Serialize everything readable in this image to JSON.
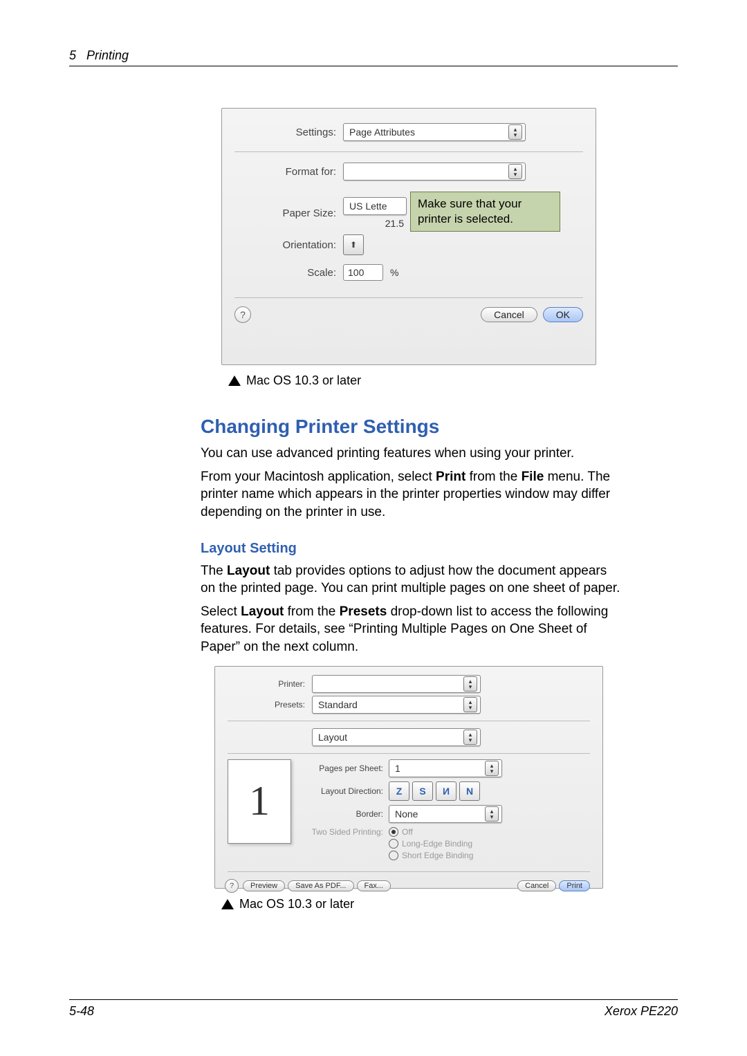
{
  "header": {
    "chapter_num": "5",
    "chapter_title": "Printing"
  },
  "dialog1": {
    "rows": {
      "settings": {
        "label": "Settings:",
        "value": "Page Attributes"
      },
      "format_for": {
        "label": "Format for:",
        "value": ""
      },
      "paper_size": {
        "label": "Paper Size:",
        "value": "US Lette",
        "sub": "21.5"
      },
      "orientation": {
        "label": "Orientation:"
      },
      "scale": {
        "label": "Scale:",
        "value": "100",
        "unit": "%"
      }
    },
    "callout": "Make sure that your printer is selected.",
    "buttons": {
      "cancel": "Cancel",
      "ok": "OK"
    }
  },
  "caption1": "Mac OS 10.3 or later",
  "section": {
    "title": "Changing Printer Settings",
    "p1": "You can use advanced printing features when using your printer.",
    "p2_a": "From your Macintosh application, select ",
    "p2_b": "Print",
    "p2_c": " from the ",
    "p2_d": "File",
    "p2_e": " menu. The printer name which appears in the printer properties window may differ depending on the printer in use."
  },
  "subsection": {
    "title": "Layout Setting",
    "p1_a": "The ",
    "p1_b": "Layout",
    "p1_c": " tab provides options to adjust how the document appears on the printed page. You can print multiple pages on one sheet of paper.",
    "p2_a": "Select ",
    "p2_b": "Layout",
    "p2_c": " from the ",
    "p2_d": "Presets",
    "p2_e": " drop-down list to access the following features. For details, see “Printing Multiple Pages on One Sheet of Paper” on the next column."
  },
  "dialog2": {
    "printer_label": "Printer:",
    "presets_label": "Presets:",
    "presets_value": "Standard",
    "pane_value": "Layout",
    "preview_digit": "1",
    "pages_label": "Pages per Sheet:",
    "pages_value": "1",
    "dir_label": "Layout Direction:",
    "border_label": "Border:",
    "border_value": "None",
    "two_sided_label": "Two Sided Printing:",
    "two_sided": {
      "off": "Off",
      "long": "Long-Edge Binding",
      "short": "Short Edge Binding"
    },
    "buttons": {
      "preview": "Preview",
      "save": "Save As PDF...",
      "fax": "Fax...",
      "cancel": "Cancel",
      "print": "Print"
    }
  },
  "caption2": "Mac OS 10.3 or later",
  "footer": {
    "page": "5-48",
    "product": "Xerox PE220"
  }
}
